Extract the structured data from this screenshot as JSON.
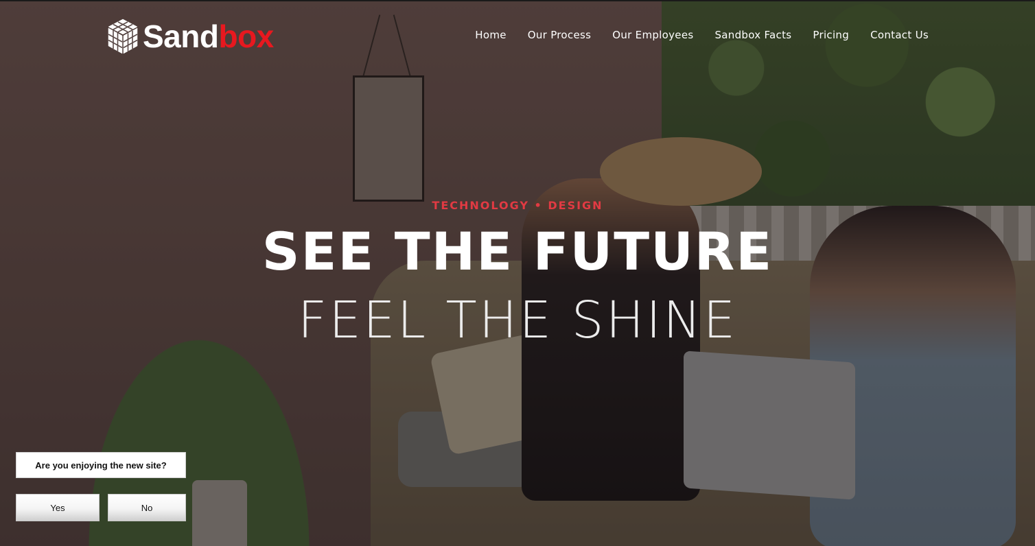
{
  "brand": {
    "logo_part1": "Sand",
    "logo_part2": "box",
    "accent_color": "#e8181f",
    "logo_icon": "cube-icon"
  },
  "nav": {
    "items": [
      {
        "label": "Home"
      },
      {
        "label": "Our Process"
      },
      {
        "label": "Our Employees"
      },
      {
        "label": "Sandbox Facts"
      },
      {
        "label": "Pricing"
      },
      {
        "label": "Contact Us"
      }
    ]
  },
  "hero": {
    "eyebrow": "TECHNOLOGY • DESIGN",
    "headline": "SEE THE FUTURE",
    "subheadline": "FEEL THE SHINE",
    "eyebrow_color": "#e23a43"
  },
  "survey": {
    "question": "Are you enjoying the new site?",
    "yes_label": "Yes",
    "no_label": "No"
  }
}
